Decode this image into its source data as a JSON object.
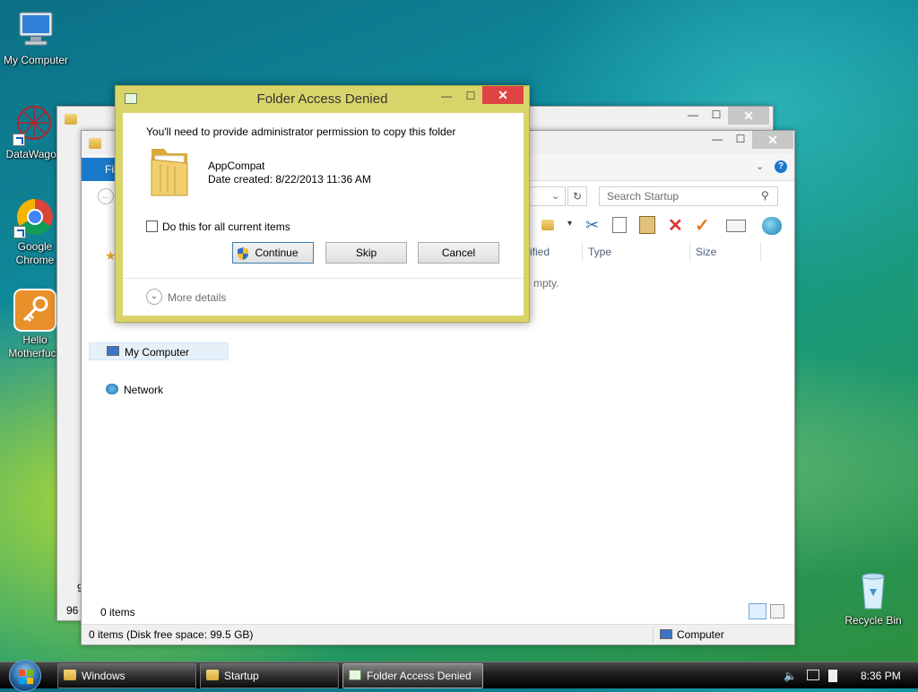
{
  "desktop": {
    "icons": [
      {
        "label": "My Computer"
      },
      {
        "label": "DataWagon"
      },
      {
        "label": "Google Chrome"
      },
      {
        "label": "Hello Motherfuck"
      },
      {
        "label": "Recycle Bin"
      }
    ]
  },
  "explorer_back": {
    "status_fragment": "96",
    "left_fragment": "9"
  },
  "explorer_front": {
    "ribbon_tab": "Fil",
    "search_placeholder": "Search Startup",
    "columns": [
      "ified",
      "Type",
      "Size"
    ],
    "empty_message": "mpty.",
    "nav": {
      "my_computer": "My Computer",
      "network": "Network"
    },
    "items_count": "0 items",
    "status_left": "0 items (Disk free space: 99.5 GB)",
    "status_right": "Computer"
  },
  "dialog": {
    "title": "Folder Access Denied",
    "message": "You'll need to provide administrator permission to copy this folder",
    "folder_name": "AppCompat",
    "date_created": "Date created: 8/22/2013 11:36 AM",
    "checkbox_label": "Do this for all current items",
    "continue_label": "Continue",
    "skip_label": "Skip",
    "cancel_label": "Cancel",
    "more_details": "More details",
    "accent": "#d9d46a",
    "close_color": "#e04343"
  },
  "taskbar": {
    "buttons": [
      {
        "label": "Windows"
      },
      {
        "label": "Startup"
      },
      {
        "label": "Folder Access Denied"
      }
    ],
    "clock": "8:36 PM"
  }
}
